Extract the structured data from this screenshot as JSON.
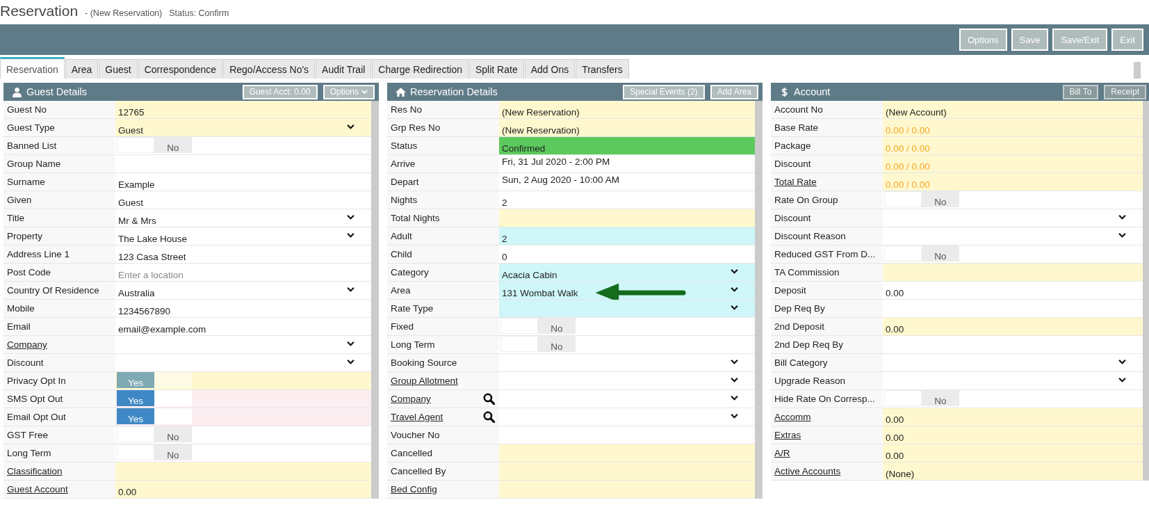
{
  "page": {
    "title": "Reservation",
    "subtitle": "- (New Reservation)",
    "status": "Status: Confirm"
  },
  "toolbar": [
    {
      "label": "Options"
    },
    {
      "label": "Save"
    },
    {
      "label": "Save/Exit"
    },
    {
      "label": "Exit"
    }
  ],
  "tabs": [
    {
      "label": "Reservation",
      "selected": true
    },
    {
      "label": "Area",
      "selected": false
    },
    {
      "label": "Guest",
      "selected": false
    },
    {
      "label": "Correspondence",
      "selected": false
    },
    {
      "label": "Rego/Access No's",
      "selected": false
    },
    {
      "label": "Audit Trail",
      "selected": false
    },
    {
      "label": "Charge Redirection",
      "selected": false
    },
    {
      "label": "Split Rate",
      "selected": false
    },
    {
      "label": "Add Ons",
      "selected": false
    },
    {
      "label": "Transfers",
      "selected": false
    }
  ],
  "panels": [
    {
      "title": "Guest Details",
      "buttons": [
        {
          "label": "Guest Acct: 0.00",
          "disabled": false,
          "caret": false
        },
        {
          "label": "Options",
          "disabled": false,
          "caret": true
        }
      ],
      "rows": [
        {
          "label": "Guest No",
          "link": false,
          "kind": "text",
          "value": "12765",
          "color": "#fff8cf"
        },
        {
          "label": "Guest Type",
          "link": false,
          "kind": "select",
          "value": "Guest",
          "color": "#fff8cf"
        },
        {
          "label": "Banned List",
          "link": false,
          "kind": "toggle",
          "value": "No",
          "on": false,
          "disabled": false,
          "color": "#ffffff"
        },
        {
          "label": "Group Name",
          "link": false,
          "kind": "text",
          "color": "#ffffff"
        },
        {
          "label": "Surname",
          "link": false,
          "kind": "text",
          "value": "Example",
          "color": "#ffffff"
        },
        {
          "label": "Given",
          "link": false,
          "kind": "text",
          "value": "Guest",
          "color": "#ffffff"
        },
        {
          "label": "Title",
          "link": false,
          "kind": "select",
          "value": "Mr & Mrs",
          "color": "#ffffff"
        },
        {
          "label": "Property",
          "link": false,
          "kind": "select",
          "value": "The Lake House",
          "color": "#ffffff"
        },
        {
          "label": "Address Line 1",
          "link": false,
          "kind": "text",
          "value": "123 Casa Street",
          "color": "#ffffff"
        },
        {
          "label": "Post Code",
          "link": false,
          "kind": "text",
          "placeholder": "Enter a location",
          "color": "#ffffff"
        },
        {
          "label": "Country Of Residence",
          "link": false,
          "kind": "select",
          "value": "Australia",
          "color": "#ffffff"
        },
        {
          "label": "Mobile",
          "link": false,
          "kind": "text",
          "value": "1234567890",
          "color": "#ffffff"
        },
        {
          "label": "Email",
          "link": false,
          "kind": "text",
          "value": "email@example.com",
          "color": "#ffffff"
        },
        {
          "label": "Company",
          "link": true,
          "kind": "select",
          "color": "#ffffff"
        },
        {
          "label": "Discount",
          "link": false,
          "kind": "select",
          "color": "#ffffff"
        },
        {
          "label": "Privacy Opt In",
          "link": false,
          "kind": "toggle",
          "value": "Yes",
          "on": true,
          "disabled": true,
          "color": "#fff8cf"
        },
        {
          "label": "SMS Opt Out",
          "link": false,
          "kind": "toggle",
          "value": "Yes",
          "on": true,
          "disabled": false,
          "color": "#fdeef2"
        },
        {
          "label": "Email Opt Out",
          "link": false,
          "kind": "toggle",
          "value": "Yes",
          "on": true,
          "disabled": false,
          "color": "#fdeef2"
        },
        {
          "label": "GST Free",
          "link": false,
          "kind": "toggle",
          "value": "No",
          "on": false,
          "disabled": false,
          "color": "#ffffff"
        },
        {
          "label": "Long Term",
          "link": false,
          "kind": "toggle",
          "value": "No",
          "on": false,
          "disabled": false,
          "color": "#ffffff"
        },
        {
          "label": "Classification",
          "link": true,
          "kind": "text",
          "color": "#fff8cf"
        },
        {
          "label": "Guest Account",
          "link": true,
          "kind": "text",
          "value": "0.00",
          "color": "#fff8cf"
        }
      ]
    },
    {
      "title": "Reservation Details",
      "buttons": [
        {
          "label": "Special Events (2)",
          "disabled": false,
          "caret": false
        },
        {
          "label": "Add Area",
          "disabled": false,
          "caret": false
        }
      ],
      "rows": [
        {
          "label": "Res No",
          "link": false,
          "kind": "text",
          "value": "(New Reservation)",
          "color": "#fff8cf"
        },
        {
          "label": "Grp Res No",
          "link": false,
          "kind": "text",
          "value": "(New Reservation)",
          "color": "#fff8cf"
        },
        {
          "label": "Status",
          "link": false,
          "kind": "text",
          "value": "Confirmed",
          "color": "#5cc95c"
        },
        {
          "label": "Arrive",
          "link": false,
          "kind": "date",
          "value": "Fri, 31 Jul 2020 - 2:00 PM",
          "color": "#ffffff"
        },
        {
          "label": "Depart",
          "link": false,
          "kind": "date",
          "value": "Sun, 2 Aug 2020 - 10:00 AM",
          "color": "#ffffff"
        },
        {
          "label": "Nights",
          "link": false,
          "kind": "text",
          "value": "2",
          "color": "#ffffff"
        },
        {
          "label": "Total Nights",
          "link": false,
          "kind": "text",
          "color": "#fff8cf"
        },
        {
          "label": "Adult",
          "link": false,
          "kind": "text",
          "value": "2",
          "color": "#cff6f9"
        },
        {
          "label": "Child",
          "link": false,
          "kind": "text",
          "value": "0",
          "color": "#ffffff"
        },
        {
          "label": "Category",
          "link": false,
          "kind": "select",
          "value": "Acacia Cabin",
          "color": "#cff6f9"
        },
        {
          "label": "Area",
          "link": false,
          "kind": "select",
          "value": "131 Wombat Walk",
          "color": "#cff6f9",
          "pointer": true
        },
        {
          "label": "Rate Type",
          "link": false,
          "kind": "select",
          "color": "#cff6f9"
        },
        {
          "label": "Fixed",
          "link": false,
          "kind": "toggle",
          "value": "No",
          "on": false,
          "disabled": false,
          "color": "#ffffff"
        },
        {
          "label": "Long Term",
          "link": false,
          "kind": "toggle",
          "value": "No",
          "on": false,
          "disabled": false,
          "color": "#ffffff"
        },
        {
          "label": "Booking Source",
          "link": false,
          "kind": "select",
          "color": "#ffffff"
        },
        {
          "label": "Group Allotment",
          "link": true,
          "kind": "select",
          "color": "#ffffff"
        },
        {
          "label": "Company",
          "link": true,
          "search": true,
          "kind": "select",
          "color": "#ffffff"
        },
        {
          "label": "Travel Agent",
          "link": true,
          "search": true,
          "kind": "select",
          "color": "#ffffff"
        },
        {
          "label": "Voucher No",
          "link": false,
          "kind": "text",
          "color": "#ffffff"
        },
        {
          "label": "Cancelled",
          "link": false,
          "kind": "text",
          "color": "#fff8cf"
        },
        {
          "label": "Cancelled By",
          "link": false,
          "kind": "text",
          "color": "#fff8cf"
        },
        {
          "label": "Bed Config",
          "link": true,
          "kind": "text",
          "color": "#fff8cf"
        }
      ]
    },
    {
      "title": "Account",
      "buttons": [
        {
          "label": "Bill To",
          "disabled": true,
          "caret": false
        },
        {
          "label": "Receipt",
          "disabled": true,
          "caret": false
        }
      ],
      "rows": [
        {
          "label": "Account No",
          "link": false,
          "kind": "text",
          "value": "(New Account)",
          "color": "#fff8cf"
        },
        {
          "label": "Base Rate",
          "link": false,
          "kind": "text",
          "value": "0.00 / 0.00",
          "accent": true,
          "color": "#fff8cf"
        },
        {
          "label": "Package",
          "link": false,
          "kind": "text",
          "value": "0.00 / 0.00",
          "accent": true,
          "color": "#fff8cf"
        },
        {
          "label": "Discount",
          "link": false,
          "kind": "text",
          "value": "0.00 / 0.00",
          "accent": true,
          "color": "#fff8cf"
        },
        {
          "label": "Total Rate",
          "link": true,
          "kind": "text",
          "value": "0.00 / 0.00",
          "accent": true,
          "color": "#fff8cf"
        },
        {
          "label": "Rate On Group",
          "link": false,
          "kind": "toggle",
          "value": "No",
          "on": false,
          "disabled": false,
          "color": "#ffffff"
        },
        {
          "label": "Discount",
          "link": false,
          "kind": "select",
          "color": "#ffffff"
        },
        {
          "label": "Discount Reason",
          "link": false,
          "kind": "select",
          "color": "#ffffff"
        },
        {
          "label": "Reduced GST From D...",
          "link": false,
          "kind": "toggle",
          "value": "No",
          "on": false,
          "disabled": false,
          "color": "#ffffff"
        },
        {
          "label": "TA Commission",
          "link": false,
          "kind": "text",
          "color": "#fff8cf"
        },
        {
          "label": "Deposit",
          "link": false,
          "kind": "text",
          "value": "0.00",
          "color": "#ffffff"
        },
        {
          "label": "Dep Req By",
          "link": false,
          "kind": "text",
          "color": "#ffffff"
        },
        {
          "label": "2nd Deposit",
          "link": false,
          "kind": "text",
          "value": "0.00",
          "color": "#fff8cf"
        },
        {
          "label": "2nd Dep Req By",
          "link": false,
          "kind": "text",
          "color": "#ffffff"
        },
        {
          "label": "Bill Category",
          "link": false,
          "kind": "select",
          "color": "#ffffff"
        },
        {
          "label": "Upgrade Reason",
          "link": false,
          "kind": "select",
          "color": "#ffffff"
        },
        {
          "label": "Hide Rate On Corresp...",
          "link": false,
          "kind": "toggle",
          "value": "No",
          "on": false,
          "disabled": false,
          "color": "#ffffff"
        },
        {
          "label": "Accomm",
          "link": true,
          "kind": "text",
          "value": "0.00",
          "color": "#fff8cf"
        },
        {
          "label": "Extras",
          "link": true,
          "kind": "text",
          "value": "0.00",
          "color": "#fff8cf"
        },
        {
          "label": "A/R",
          "link": true,
          "kind": "text",
          "value": "0.00",
          "color": "#fff8cf"
        },
        {
          "label": "Active Accounts",
          "link": true,
          "kind": "text",
          "value": "(None)",
          "color": "#fff8cf"
        }
      ]
    }
  ]
}
